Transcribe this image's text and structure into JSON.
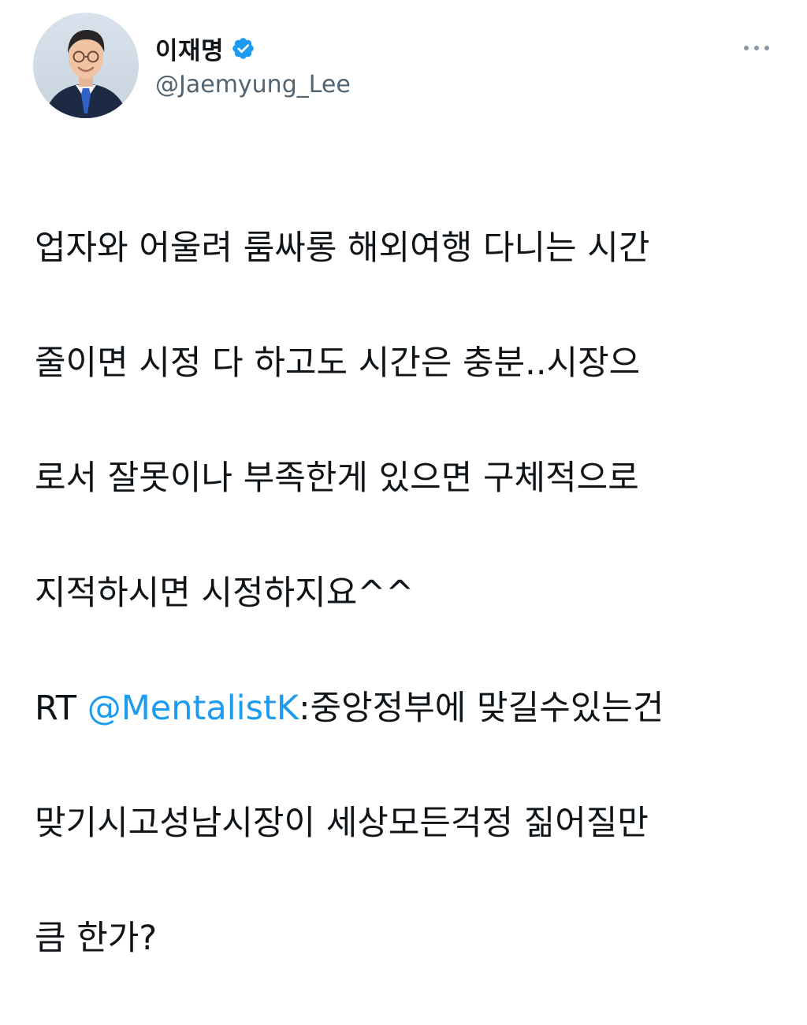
{
  "author": {
    "display_name": "이재명",
    "handle": "@Jaemyung_Lee",
    "verified": true
  },
  "menu": {
    "icon": "more-horizontal-icon"
  },
  "colors": {
    "text": "#0f1419",
    "secondary": "#536471",
    "mention": "#1d9bf0",
    "verified_badge": "#1d9bf0"
  },
  "tweet": {
    "lines": [
      "업자와 어울려 룸싸롱 해외여행 다니는 시간",
      "줄이면 시정 다 하고도 시간은 충분..시장으",
      "로서 잘못이나 부족한게 있으면 구체적으로",
      "지적하시면 시정하지요^^"
    ],
    "rt_prefix": "RT ",
    "mention": "@MentalistK",
    "rt_line1_rest": ":중앙정부에 맞길수있는건",
    "rt_lines": [
      "맞기시고성남시장이 세상모든걱정 짊어질만",
      "큼 한가?"
    ]
  }
}
